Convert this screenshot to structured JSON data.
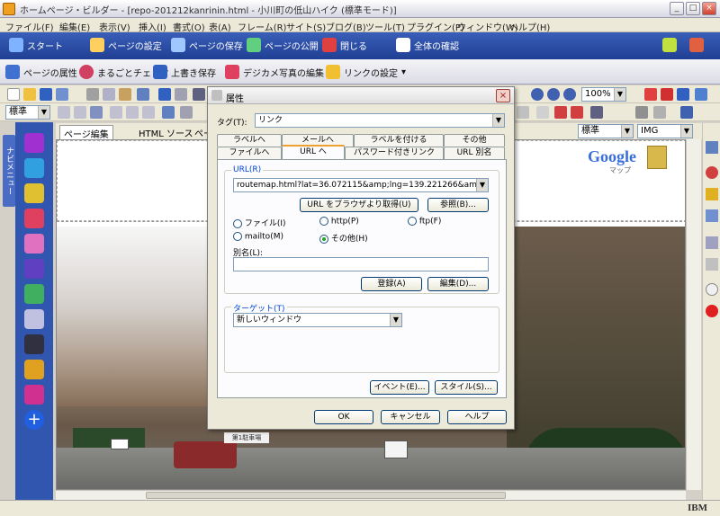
{
  "window": {
    "title": "ホームページ・ビルダー - [repo-201212kanrinin.html - 小川町の低山ハイク (標準モード)]",
    "controls": [
      "_",
      "□",
      "×"
    ]
  },
  "menu": [
    "ファイル(F)",
    "編集(E)",
    "表示(V)",
    "挿入(I)",
    "書式(O)",
    "表(A)",
    "フレーム(R)",
    "サイト(S)",
    "ブログ(B)",
    "ツール(T)",
    "プラグイン(P)",
    "ウィンドウ(W)",
    "ヘルプ(H)"
  ],
  "toolbar_main": {
    "start": "スタート",
    "page_settings": "ページの設定",
    "save_page": "ページの保存",
    "publish_page": "ページの公開",
    "close": "閉じる",
    "overall_check": "全体の確認"
  },
  "toolbar_sub": {
    "page_attr": "ページの属性",
    "full_check": "まるごとチェック",
    "overwrite_save": "上書き保存",
    "edit_photo": "デジカメ写真の編集",
    "link_settings": "リンクの設定"
  },
  "toolbar_std": {
    "zoom": "100%",
    "style": "標準"
  },
  "doc_tabs": {
    "page_edit": "ページ編集",
    "html_source": "HTML ソース",
    "preview": "ペー"
  },
  "navigator_label": "ナビメニュー",
  "right_combos": {
    "standard": "標準",
    "img": "IMG"
  },
  "page_logo": "Google",
  "page_logo_sub": "マップ",
  "photo_sign": "第1駐車場",
  "status_ibm": "IBM",
  "dialog": {
    "title": "属性",
    "tag_label": "タグ(T):",
    "tag_value": "リンク",
    "tabs_row1": [
      "ラベルへ",
      "メールへ",
      "ラベルを付ける",
      "その他"
    ],
    "tabs_row2": [
      "ファイルへ",
      "URL へ",
      "パスワード付きリンク",
      "URL 別名"
    ],
    "url_label": "URL(R)",
    "url_value": "routemap.html?lat=36.072115&amp;lng=139.221266&amp;url=http://y",
    "get_from_browser": "URL をブラウザより取得(U)",
    "browse": "参照(B)...",
    "radio_file": "ファイル(I)",
    "radio_http": "http(P)",
    "radio_ftp": "ftp(F)",
    "radio_mailto": "mailto(M)",
    "radio_other": "その他(H)",
    "alias_label": "別名(L):",
    "alias_value": "",
    "register": "登録(A)",
    "edit": "編集(D)...",
    "target_label": "ターゲット(T)",
    "target_value": "新しいウィンドウ",
    "event": "イベント(E)...",
    "style": "スタイル(S)...",
    "ok": "OK",
    "cancel": "キャンセル",
    "help": "ヘルプ"
  },
  "colors": {
    "blue_toolbar": "#2a4ea6",
    "dialog_bg": "#ece9d8",
    "radio_dot": "#21a121"
  }
}
